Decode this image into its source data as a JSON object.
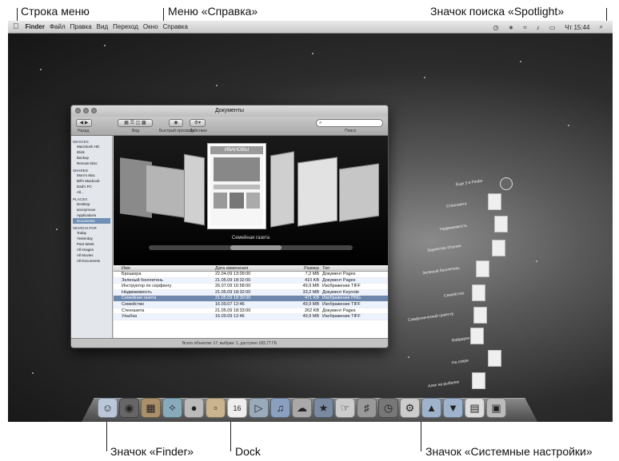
{
  "callouts": {
    "menu_bar": "Строка меню",
    "help_menu": "Меню «Справка»",
    "spotlight": "Значок поиска «Spotlight»",
    "finder_icon": "Значок «Finder»",
    "dock": "Dock",
    "system_prefs": "Значок «Системные настройки»"
  },
  "menubar": {
    "apple": "",
    "items": [
      "Finder",
      "Файл",
      "Правка",
      "Вид",
      "Переход",
      "Окно",
      "Справка"
    ],
    "clock": "Чт 15:44"
  },
  "finder_window": {
    "title": "Документы",
    "toolbar": {
      "back_label": "Назад",
      "view_label": "Вид",
      "quicklook_label": "Быстрый просмотр",
      "action_label": "Действие",
      "search_label": "Поиск"
    },
    "sidebar": [
      {
        "section": "DEVICES",
        "items": [
          "Macintosh HD",
          "iDisk",
          "Backup",
          "Remote Disc"
        ]
      },
      {
        "section": "SHARED",
        "items": [
          "Mom's Mac",
          "Bill's Macbook",
          "Dad's PC",
          "All..."
        ]
      },
      {
        "section": "PLACES",
        "items": [
          "Desktop",
          "anonymous",
          "Applications",
          "Documents"
        ]
      },
      {
        "section": "SEARCH FOR",
        "items": [
          "Today",
          "Yesterday",
          "Past Week",
          "All Images",
          "All Movies",
          "All Documents"
        ]
      }
    ],
    "coverflow": {
      "center_doc_heading": "ИВАНОВЫ",
      "selected_caption": "Семейная газета"
    },
    "columns": [
      "Имя",
      "Дата изменения",
      "Размер",
      "Тип"
    ],
    "rows": [
      [
        "Брошюра",
        "22.04.09 13:09:00",
        "7,2 MB",
        "Документ Pages"
      ],
      [
        "Зеленый бюллетень",
        "21.05.09 18:32:00",
        "410 KB",
        "Документ Pages"
      ],
      [
        "Инструктор по серфингу",
        "26.07.09 16:58:00",
        "49,9 MB",
        "Изображение TIFF"
      ],
      [
        "Недвижимость",
        "21.05.09 18:32:00",
        "33,2 MB",
        "Документ Keynote"
      ],
      [
        "Семейная газета",
        "21.05.09 18:30:00",
        "471 KB",
        "Изображение PNG"
      ],
      [
        "Семейство",
        "16.09.07 12:46",
        "49,9 MB",
        "Изображение TIFF"
      ],
      [
        "Стенгазета",
        "21.05.09 18:33:00",
        "262 KB",
        "Документ Pages"
      ],
      [
        "Улыбка",
        "16.09.09 12:46",
        "49,9 MB",
        "Изображение TIFF"
      ]
    ],
    "status": "Всего объектов: 17, выбран: 1, доступно 183,77 ГБ"
  },
  "stack": [
    "Еще 3 в Finder",
    "Стенгазета",
    "Недвижимость",
    "Зодчество Италии",
    "Зеленый бюллетень",
    "Семейство",
    "Симфонический оркестр",
    "Байдарки",
    "На озере",
    "Алек на рыбалке"
  ],
  "dock_icons": [
    "finder-icon",
    "dashboard-icon",
    "photo-icon",
    "safari-icon",
    "ichat-icon",
    "address-book-icon",
    "ical-icon",
    "preview-icon",
    "itunes-icon",
    "iphoto-icon",
    "imovie-icon",
    "iweb-icon",
    "garageband-icon",
    "time-machine-icon",
    "system-preferences-icon",
    "folder-icon",
    "downloads-icon",
    "documents-stack-icon",
    "trash-icon"
  ]
}
